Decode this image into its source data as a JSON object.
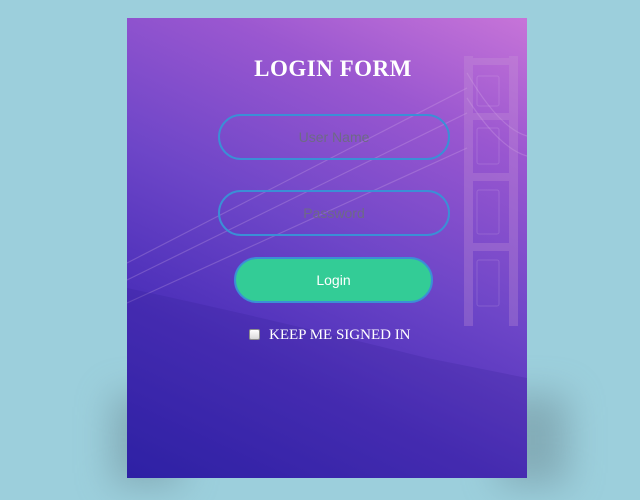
{
  "form": {
    "title": "LOGIN FORM",
    "username_placeholder": "User Name",
    "username_value": "",
    "password_placeholder": "Password",
    "password_value": "",
    "login_label": "Login",
    "remember_label": "KEEP ME SIGNED IN",
    "remember_checked": false
  },
  "colors": {
    "page_background": "#9ccfdc",
    "gradient_top": "#c774d8",
    "gradient_bottom": "#2e22aa",
    "field_border": "#3b8fd6",
    "button_fill": "#33cc96",
    "text": "#ffffff"
  }
}
